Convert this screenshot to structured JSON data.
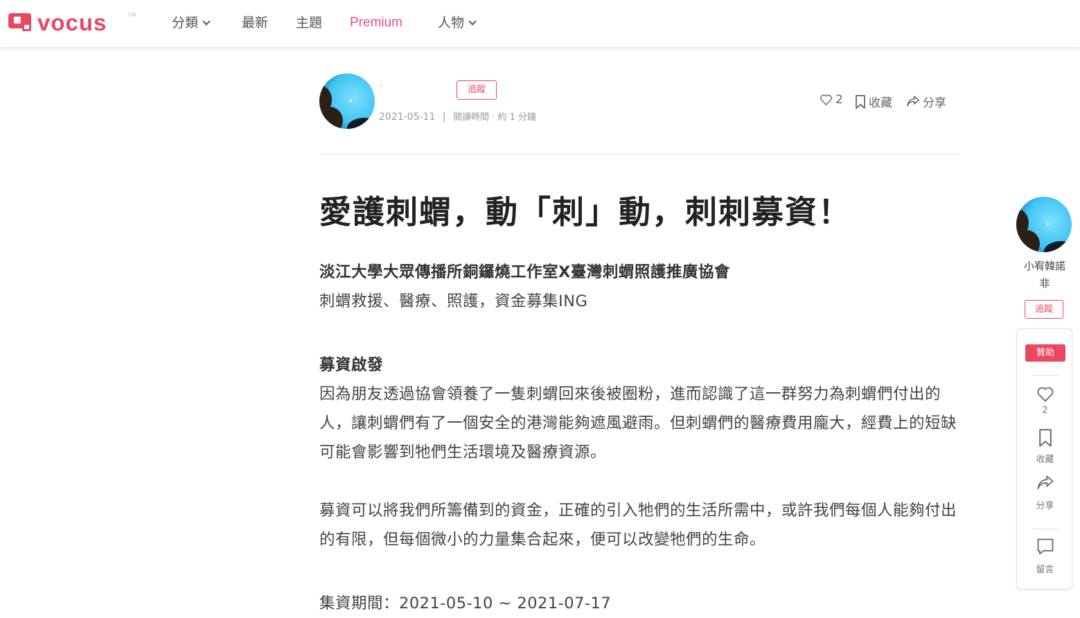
{
  "nav": {
    "logo_text": "vocus",
    "logo_superscript": "TW",
    "items": [
      {
        "label": "分類",
        "has_dropdown": true
      },
      {
        "label": "最新",
        "has_dropdown": false
      },
      {
        "label": "主題",
        "has_dropdown": false
      },
      {
        "label": "Premium",
        "has_dropdown": false
      },
      {
        "label": "人物",
        "has_dropdown": true
      }
    ]
  },
  "author": {
    "name_fragment": "- ",
    "follow_label": "追蹤",
    "date": "2021-05-11",
    "separator": "|",
    "read_time": "閱讀時間 · 約 1 分鐘"
  },
  "actions": {
    "likes": "2",
    "bookmark_label": "收藏",
    "share_label": "分享"
  },
  "article": {
    "title": "愛護刺蝟，動「刺」動，刺刺募資！",
    "subtitle_bold": "淡江大學大眾傳播所銅鑼燒工作室X臺灣刺蝟照護推廣協會",
    "subtitle": "刺蝟救援、醫療、照護，資金募集ING",
    "section_heading": "募資啟發",
    "para1": "因為朋友透過協會領養了一隻刺蝟回來後被圈粉，進而認識了這一群努力為刺蝟們付出的人，讓刺蝟們有了一個安全的港灣能夠遮風避雨。但刺蝟們的醫療費用龐大，經費上的短缺可能會影響到牠們生活環境及醫療資源。",
    "para2": "募資可以將我們所籌備到的資金，正確的引入牠們的生活所需中，或許我們每個人能夠付出的有限，但每個微小的力量集合起來，便可以改變牠們的生命。",
    "period": "集資期間：2021-05-10 ~ 2021-07-17"
  },
  "sidebar": {
    "author_name_line1": "小宥韓諾",
    "author_name_line2": "非",
    "follow_label": "追蹤",
    "sponsor_label": "贊助",
    "likes": "2",
    "bookmark_label": "收藏",
    "share_label": "分享",
    "comment_label": "留言"
  },
  "colors": {
    "brand": "#ea4760",
    "premium": "#e84a8c"
  }
}
